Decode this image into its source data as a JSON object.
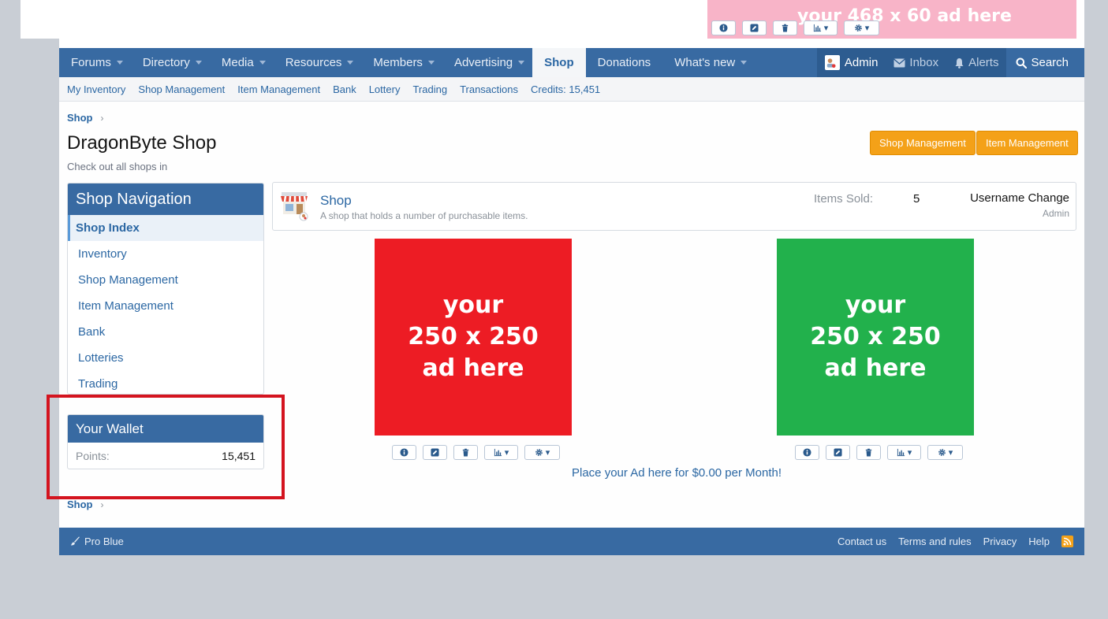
{
  "banner": {
    "ad_text": "your 468 x 60 ad here"
  },
  "nav": {
    "tabs": [
      {
        "label": "Forums",
        "caret": true
      },
      {
        "label": "Directory",
        "caret": true
      },
      {
        "label": "Media",
        "caret": true
      },
      {
        "label": "Resources",
        "caret": true
      },
      {
        "label": "Members",
        "caret": true
      },
      {
        "label": "Advertising",
        "caret": true
      },
      {
        "label": "Shop",
        "caret": false,
        "active": true
      },
      {
        "label": "Donations",
        "caret": false
      },
      {
        "label": "What's new",
        "caret": true
      }
    ],
    "account": {
      "username": "Admin",
      "inbox": "Inbox",
      "alerts": "Alerts"
    },
    "search": "Search"
  },
  "subnav": {
    "links": [
      "My Inventory",
      "Shop Management",
      "Item Management",
      "Bank",
      "Lottery",
      "Trading",
      "Transactions",
      "Credits: 15,451"
    ]
  },
  "breadcrumb": {
    "label": "Shop"
  },
  "page": {
    "title": "DragonByte Shop",
    "description": "Check out all shops in",
    "buttons": {
      "shop_management": "Shop Management",
      "item_management": "Item Management"
    }
  },
  "sidebar": {
    "title": "Shop Navigation",
    "items": [
      "Shop Index",
      "Inventory",
      "Shop Management",
      "Item Management",
      "Bank",
      "Lotteries",
      "Trading"
    ],
    "selected_index": 0,
    "wallet": {
      "title": "Your Wallet",
      "label": "Points:",
      "value": "15,451"
    }
  },
  "shop": {
    "name": "Shop",
    "description": "A shop that holds a number of purchasable items.",
    "items_sold_label": "Items Sold:",
    "items_sold_value": "5",
    "latest_item": "Username Change",
    "latest_by": "Admin"
  },
  "ads": {
    "square_left": {
      "lines": [
        "your",
        "250 x 250",
        "ad here"
      ],
      "color": "#ed1c24"
    },
    "square_right": {
      "lines": [
        "your",
        "250 x 250",
        "ad here"
      ],
      "color": "#22b14c"
    },
    "place_ad": "Place your Ad here for $0.00 per Month!"
  },
  "footer": {
    "style": "Pro Blue",
    "links": [
      "Contact us",
      "Terms and rules",
      "Privacy",
      "Help"
    ]
  },
  "colors": {
    "brand_blue": "#386aa2",
    "link_blue": "#2b67a3",
    "button_orange": "#f4a118",
    "highlight_red": "#d4141f",
    "banner_pink": "#f8b4c8"
  }
}
